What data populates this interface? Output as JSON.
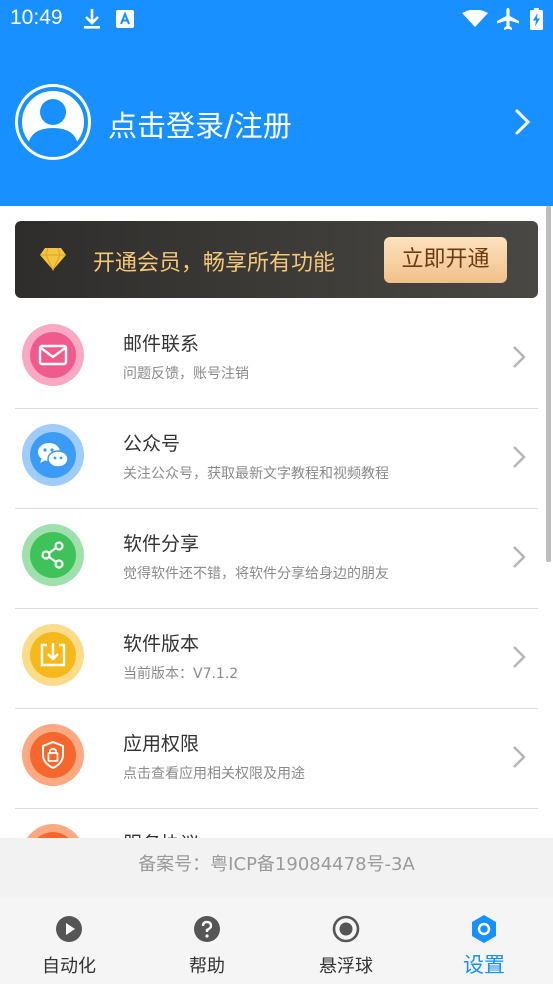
{
  "status": {
    "time": "10:49"
  },
  "header": {
    "login_text": "点击登录/注册"
  },
  "vip": {
    "text": "开通会员，畅享所有功能",
    "button": "立即开通"
  },
  "items": [
    {
      "title": "邮件联系",
      "subtitle": "问题反馈，账号注销",
      "icon": "mail-icon",
      "color": "#ef5b8c"
    },
    {
      "title": "公众号",
      "subtitle": "关注公众号，获取最新文字教程和视频教程",
      "icon": "wechat-icon",
      "color": "#3c9cf5"
    },
    {
      "title": "软件分享",
      "subtitle": "觉得软件还不错，将软件分享给身边的朋友",
      "icon": "share-icon",
      "color": "#3fc25a"
    },
    {
      "title": "软件版本",
      "subtitle": "当前版本：V7.1.2",
      "icon": "download-icon",
      "color": "#f6b91c"
    },
    {
      "title": "应用权限",
      "subtitle": "点击查看应用相关权限及用途",
      "icon": "lock-shield-icon",
      "color": "#f6672d"
    },
    {
      "title": "服务协议",
      "subtitle": "",
      "icon": "agreement-icon",
      "color": "#f6672d"
    }
  ],
  "icp": "备案号：粤ICP备19084478号-3A",
  "tabs": [
    {
      "label": "自动化",
      "icon": "play-icon",
      "active": false
    },
    {
      "label": "帮助",
      "icon": "help-icon",
      "active": false
    },
    {
      "label": "悬浮球",
      "icon": "floating-ball-icon",
      "active": false
    },
    {
      "label": "设置",
      "icon": "settings-gear-icon",
      "active": true
    }
  ],
  "colors": {
    "primary": "#1890ff",
    "vip_gold": "#f4c77b"
  }
}
